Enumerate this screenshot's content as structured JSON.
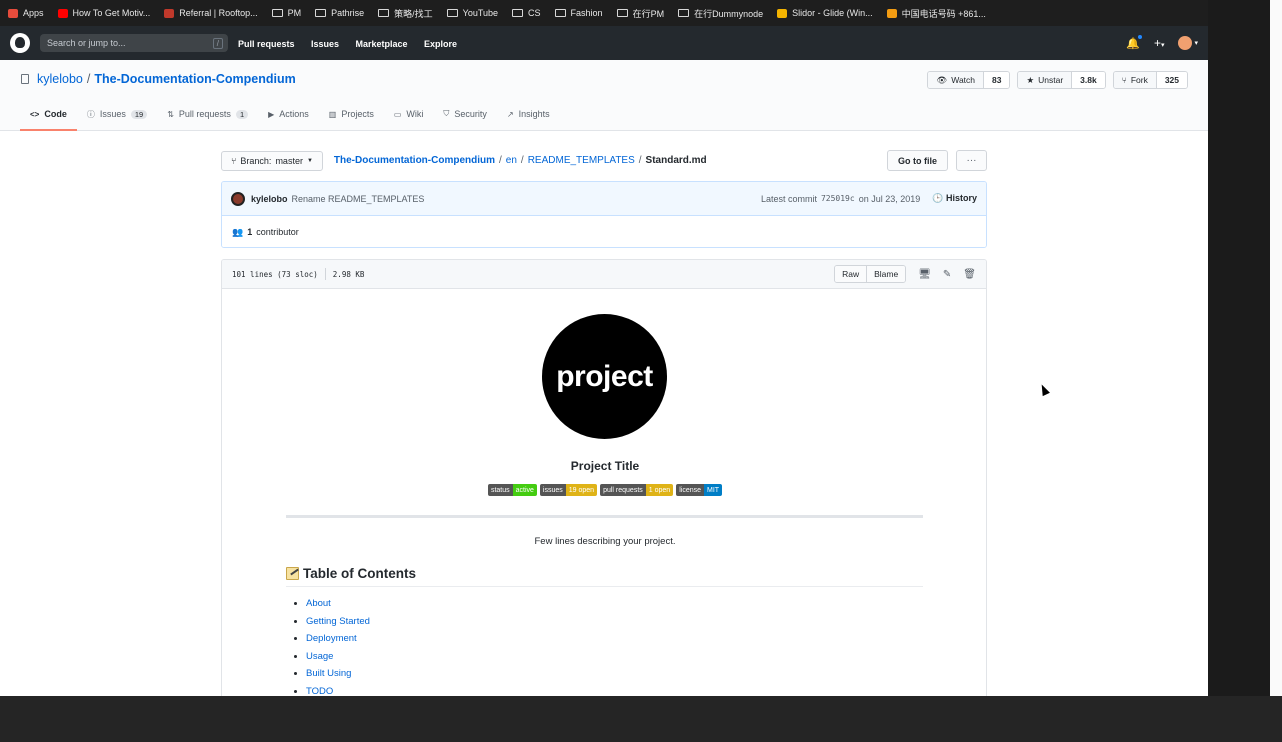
{
  "bookmarks": [
    {
      "label": "Apps",
      "color": "#e74c3c",
      "kind": "apps-icon"
    },
    {
      "label": "How To Get Motiv...",
      "color": "#ff0000",
      "kind": "youtube-icon"
    },
    {
      "label": "Referral | Rooftop...",
      "color": "#c0392b",
      "kind": "site-icon"
    },
    {
      "label": "PM",
      "kind": "folder-icon"
    },
    {
      "label": "Pathrise",
      "kind": "folder-icon"
    },
    {
      "label": "策略/找工",
      "kind": "folder-icon"
    },
    {
      "label": "YouTube",
      "kind": "folder-icon"
    },
    {
      "label": "CS",
      "kind": "folder-icon"
    },
    {
      "label": "Fashion",
      "kind": "folder-icon"
    },
    {
      "label": "在行PM",
      "kind": "folder-icon"
    },
    {
      "label": "在行Dummynode",
      "kind": "folder-icon"
    },
    {
      "label": "Slidor - Glide (Win...",
      "color": "#f4b400",
      "kind": "slides-icon"
    },
    {
      "label": "中国电话号码 +861...",
      "color": "#f39c12",
      "kind": "site-icon"
    }
  ],
  "header": {
    "search_placeholder": "Search or jump to...",
    "search_shortcut": "/",
    "nav": [
      "Pull requests",
      "Issues",
      "Marketplace",
      "Explore"
    ],
    "plus": "+",
    "caret": "▾"
  },
  "repo": {
    "owner": "kylelobo",
    "separator": "/",
    "name": "The-Documentation-Compendium",
    "watch_label": "Watch",
    "watch_count": "83",
    "unstar_label": "Unstar",
    "star_count": "3.8k",
    "fork_label": "Fork",
    "fork_count": "325"
  },
  "tabs": [
    {
      "label": "Code",
      "icon": "<>",
      "name": "tab-code",
      "active": true
    },
    {
      "label": "Issues",
      "icon": "ⓘ",
      "count": "19",
      "name": "tab-issues"
    },
    {
      "label": "Pull requests",
      "icon": "⇅",
      "count": "1",
      "name": "tab-pull-requests"
    },
    {
      "label": "Actions",
      "icon": "▶",
      "name": "tab-actions"
    },
    {
      "label": "Projects",
      "icon": "▥",
      "name": "tab-projects"
    },
    {
      "label": "Wiki",
      "icon": "▭",
      "name": "tab-wiki"
    },
    {
      "label": "Security",
      "icon": "⛉",
      "name": "tab-security"
    },
    {
      "label": "Insights",
      "icon": "↗",
      "name": "tab-insights"
    }
  ],
  "filebar": {
    "branch_label": "Branch:",
    "branch": "master",
    "crumbs": [
      "The-Documentation-Compendium",
      "en",
      "README_TEMPLATES"
    ],
    "separator": "/",
    "file": "Standard.md",
    "goto_file": "Go to file",
    "more": "···"
  },
  "commit": {
    "user": "kylelobo",
    "message": "Rename README_TEMPLATES",
    "latest_label": "Latest commit",
    "sha": "725019c",
    "date": "on Jul 23, 2019",
    "history": "History",
    "contributors": "1",
    "contributors_label": "contributor"
  },
  "file": {
    "lines": "101 lines (73 sloc)",
    "size": "2.98 KB",
    "raw": "Raw",
    "blame": "Blame"
  },
  "readme": {
    "logo_text": "project",
    "title": "Project Title",
    "badges": [
      {
        "key": "status",
        "value": "active",
        "color": "#4c1"
      },
      {
        "key": "issues",
        "value": "19 open",
        "color": "#dfb317"
      },
      {
        "key": "pull requests",
        "value": "1 open",
        "color": "#dfb317"
      },
      {
        "key": "license",
        "value": "MIT",
        "color": "#007ec6"
      }
    ],
    "description": "Few lines describing your project.",
    "toc_title": "Table of Contents",
    "toc": [
      "About",
      "Getting Started",
      "Deployment",
      "Usage",
      "Built Using",
      "TODO"
    ]
  }
}
